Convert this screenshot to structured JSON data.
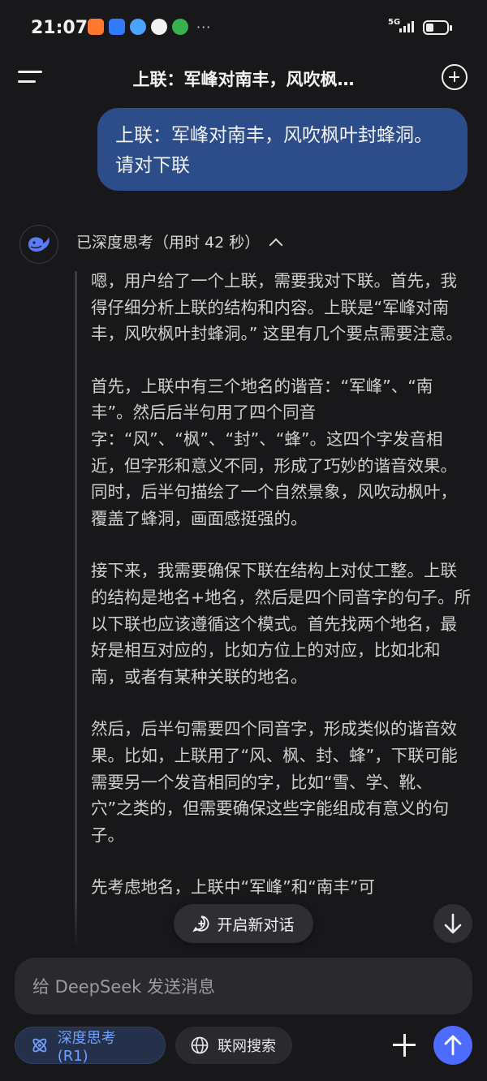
{
  "status_bar": {
    "time": "21:07",
    "network": "5G",
    "more": "···",
    "app_icons": [
      {
        "name": "taobao-icon",
        "color": "#ff7a2f"
      },
      {
        "name": "alipay-icon",
        "color": "#2f7bff"
      },
      {
        "name": "weather-icon",
        "color": "#4aa3ff"
      },
      {
        "name": "chat-bubble-icon",
        "color": "#f2f2f2"
      },
      {
        "name": "green-app-icon",
        "color": "#37b24d"
      }
    ]
  },
  "header": {
    "title": "上联：军峰对南丰，风吹枫…"
  },
  "user_message": "上联：军峰对南丰，风吹枫叶封蜂洞。请对下联",
  "thinking": {
    "header": "已深度思考（用时 42 秒）",
    "paragraphs": [
      "嗯，用户给了一个上联，需要我对下联。首先，我得仔细分析上联的结构和内容。上联是“军峰对南丰，风吹枫叶封蜂洞。” 这里有几个要点需要注意。",
      "首先，上联中有三个地名的谐音：“军峰”、“南丰”。然后后半句用了四个同音字：“风”、“枫”、“封”、“蜂”。这四个字发音相近，但字形和意义不同，形成了巧妙的谐音效果。同时，后半句描绘了一个自然景象，风吹动枫叶，覆盖了蜂洞，画面感挺强的。",
      "接下来，我需要确保下联在结构上对仗工整。上联的结构是地名+地名，然后是四个同音字的句子。所以下联也应该遵循这个模式。首先找两个地名，最好是相互对应的，比如方位上的对应，比如北和南，或者有某种关联的地名。",
      "然后，后半句需要四个同音字，形成类似的谐音效果。比如，上联用了“风、枫、封、蜂”，下联可能需要另一个发音相同的字，比如“雪、学、靴、穴”之类的，但需要确保这些字能组成有意义的句子。",
      "先考虑地名，上联中“军峰”和“南丰”可"
    ]
  },
  "new_conversation_label": "开启新对话",
  "composer": {
    "placeholder": "给 DeepSeek 发送消息",
    "deep_think_label": "深度思考 (R1)",
    "web_search_label": "联网搜索"
  },
  "colors": {
    "background": "#18181b",
    "user_bubble": "#2c4c8a",
    "accent": "#4d6bfe",
    "deep_think_text": "#6fa1ff"
  }
}
